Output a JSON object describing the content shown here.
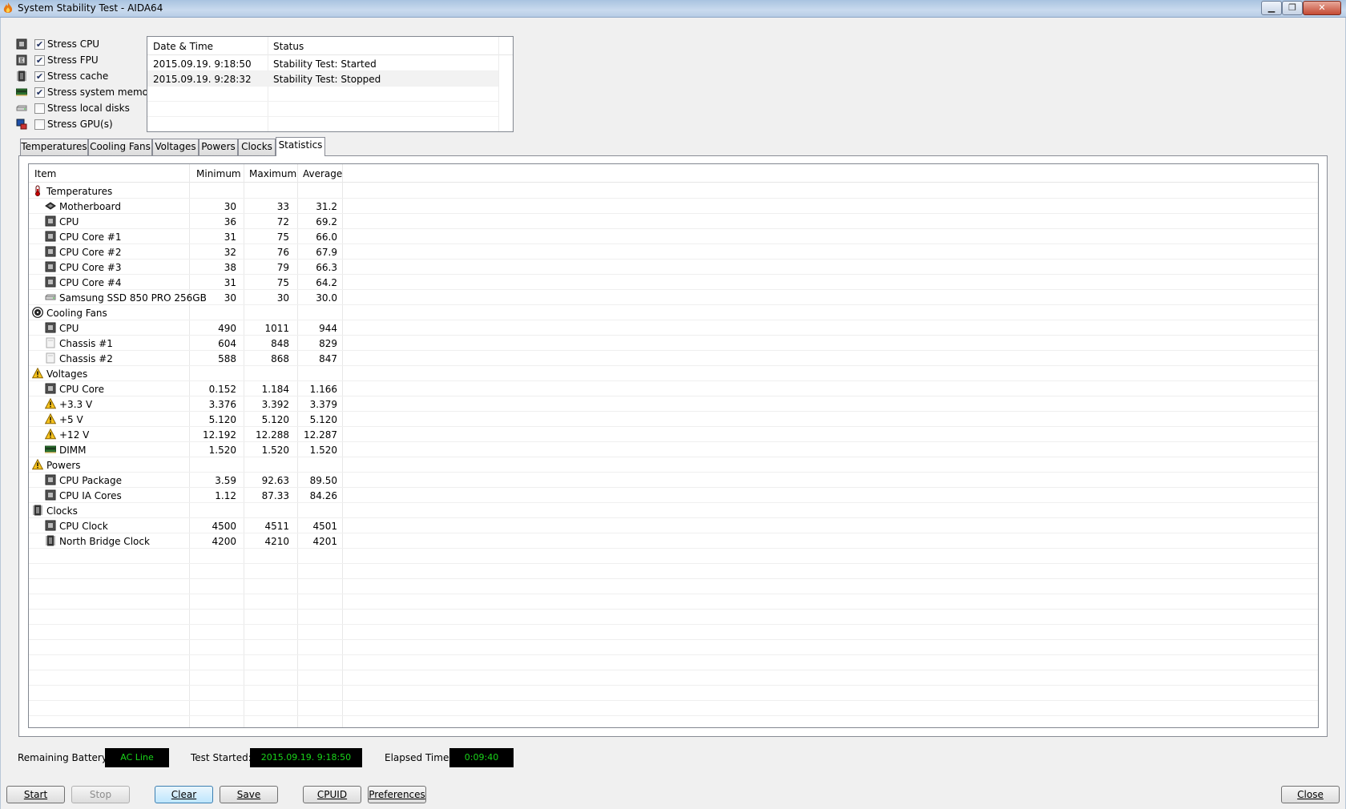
{
  "window": {
    "title": "System Stability Test - AIDA64",
    "controls": {
      "minimize": "▁",
      "maximize": "❐",
      "close": "✕"
    }
  },
  "stress_options": [
    {
      "label": "Stress CPU",
      "checked": true,
      "icon": "cpu-chip-icon"
    },
    {
      "label": "Stress FPU",
      "checked": true,
      "icon": "fpu-chip-icon"
    },
    {
      "label": "Stress cache",
      "checked": true,
      "icon": "cache-chip-icon"
    },
    {
      "label": "Stress system memory",
      "checked": true,
      "icon": "memory-module-icon"
    },
    {
      "label": "Stress local disks",
      "checked": false,
      "icon": "hard-disk-icon"
    },
    {
      "label": "Stress GPU(s)",
      "checked": false,
      "icon": "gpu-monitor-icon"
    }
  ],
  "log": {
    "columns": [
      "Date & Time",
      "Status"
    ],
    "rows": [
      {
        "datetime": "2015.09.19. 9:18:50",
        "status": "Stability Test: Started"
      },
      {
        "datetime": "2015.09.19. 9:28:32",
        "status": "Stability Test: Stopped"
      }
    ]
  },
  "tabs": [
    {
      "label": "Temperatures",
      "active": false
    },
    {
      "label": "Cooling Fans",
      "active": false
    },
    {
      "label": "Voltages",
      "active": false
    },
    {
      "label": "Powers",
      "active": false
    },
    {
      "label": "Clocks",
      "active": false
    },
    {
      "label": "Statistics",
      "active": true
    }
  ],
  "stats": {
    "columns": [
      "Item",
      "Minimum",
      "Maximum",
      "Average"
    ],
    "rows": [
      {
        "type": "group",
        "name": "Temperatures",
        "icon": "thermometer-icon"
      },
      {
        "type": "item",
        "name": "Motherboard",
        "min": "30",
        "max": "33",
        "avg": "31.2",
        "icon": "motherboard-icon"
      },
      {
        "type": "item",
        "name": "CPU",
        "min": "36",
        "max": "72",
        "avg": "69.2",
        "icon": "cpu-chip-icon"
      },
      {
        "type": "item",
        "name": "CPU Core #1",
        "min": "31",
        "max": "75",
        "avg": "66.0",
        "icon": "cpu-chip-icon"
      },
      {
        "type": "item",
        "name": "CPU Core #2",
        "min": "32",
        "max": "76",
        "avg": "67.9",
        "icon": "cpu-chip-icon"
      },
      {
        "type": "item",
        "name": "CPU Core #3",
        "min": "38",
        "max": "79",
        "avg": "66.3",
        "icon": "cpu-chip-icon"
      },
      {
        "type": "item",
        "name": "CPU Core #4",
        "min": "31",
        "max": "75",
        "avg": "64.2",
        "icon": "cpu-chip-icon"
      },
      {
        "type": "item",
        "name": "Samsung SSD 850 PRO 256GB",
        "min": "30",
        "max": "30",
        "avg": "30.0",
        "icon": "hard-disk-icon"
      },
      {
        "type": "group",
        "name": "Cooling Fans",
        "icon": "fan-icon"
      },
      {
        "type": "item",
        "name": "CPU",
        "min": "490",
        "max": "1011",
        "avg": "944",
        "icon": "cpu-chip-icon"
      },
      {
        "type": "item",
        "name": "Chassis #1",
        "min": "604",
        "max": "848",
        "avg": "829",
        "icon": "chassis-icon"
      },
      {
        "type": "item",
        "name": "Chassis #2",
        "min": "588",
        "max": "868",
        "avg": "847",
        "icon": "chassis-icon"
      },
      {
        "type": "group",
        "name": "Voltages",
        "icon": "warning-icon"
      },
      {
        "type": "item",
        "name": "CPU Core",
        "min": "0.152",
        "max": "1.184",
        "avg": "1.166",
        "icon": "cpu-chip-icon"
      },
      {
        "type": "item",
        "name": "+3.3 V",
        "min": "3.376",
        "max": "3.392",
        "avg": "3.379",
        "icon": "warning-icon"
      },
      {
        "type": "item",
        "name": "+5 V",
        "min": "5.120",
        "max": "5.120",
        "avg": "5.120",
        "icon": "warning-icon"
      },
      {
        "type": "item",
        "name": "+12 V",
        "min": "12.192",
        "max": "12.288",
        "avg": "12.287",
        "icon": "warning-icon"
      },
      {
        "type": "item",
        "name": "DIMM",
        "min": "1.520",
        "max": "1.520",
        "avg": "1.520",
        "icon": "memory-module-icon"
      },
      {
        "type": "group",
        "name": "Powers",
        "icon": "warning-icon"
      },
      {
        "type": "item",
        "name": "CPU Package",
        "min": "3.59",
        "max": "92.63",
        "avg": "89.50",
        "icon": "cpu-chip-icon"
      },
      {
        "type": "item",
        "name": "CPU IA Cores",
        "min": "1.12",
        "max": "87.33",
        "avg": "84.26",
        "icon": "cpu-chip-icon"
      },
      {
        "type": "group",
        "name": "Clocks",
        "icon": "clock-chip-icon"
      },
      {
        "type": "item",
        "name": "CPU Clock",
        "min": "4500",
        "max": "4511",
        "avg": "4501",
        "icon": "cpu-chip-icon"
      },
      {
        "type": "item",
        "name": "North Bridge Clock",
        "min": "4200",
        "max": "4210",
        "avg": "4201",
        "icon": "clock-chip-icon"
      }
    ]
  },
  "status": {
    "battery_label": "Remaining Battery:",
    "battery_value": "AC Line",
    "started_label": "Test Started:",
    "started_value": "2015.09.19. 9:18:50",
    "elapsed_label": "Elapsed Time:",
    "elapsed_value": "0:09:40"
  },
  "buttons": {
    "start": "Start",
    "stop": "Stop",
    "clear": "Clear",
    "save": "Save",
    "cpuid": "CPUID",
    "preferences": "Preferences",
    "close": "Close"
  }
}
